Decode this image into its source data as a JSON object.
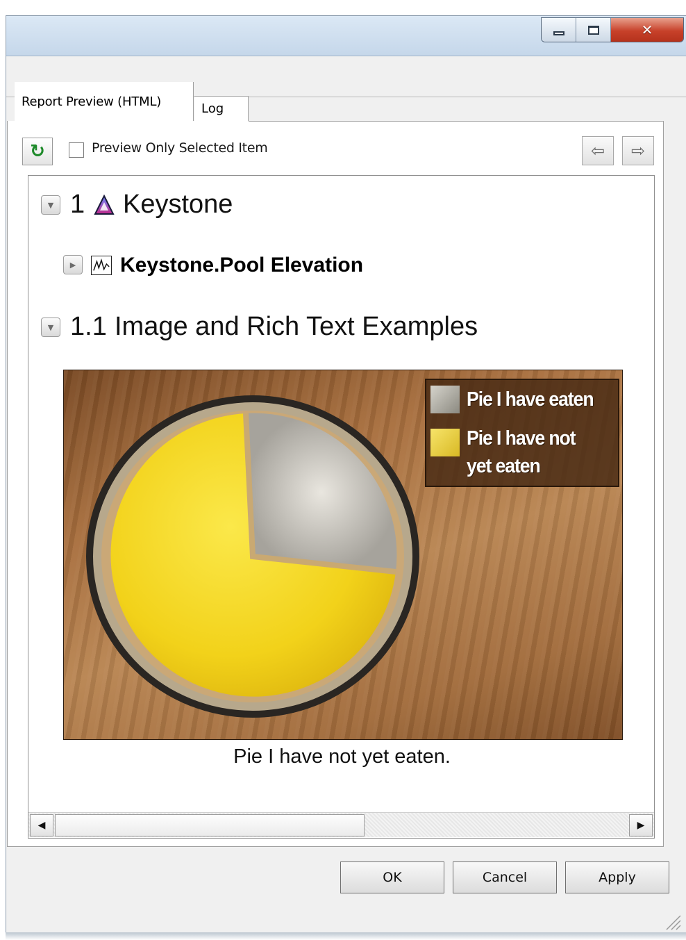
{
  "window": {
    "caption_buttons": {
      "minimize": "minimize",
      "maximize": "maximize",
      "close": "close"
    }
  },
  "tabs": [
    {
      "label": "Report Preview (HTML)",
      "active": true
    },
    {
      "label": "Log",
      "active": false
    }
  ],
  "toolbar": {
    "refresh_icon": "refresh-icon",
    "checkbox_label": "Preview Only Selected Item",
    "checkbox_checked": false,
    "back_icon": "arrow-left-icon",
    "forward_icon": "arrow-right-icon"
  },
  "report": {
    "section1": {
      "number": "1",
      "title": "Keystone",
      "icon": "triangle-icon"
    },
    "subitem": {
      "title": "Keystone.Pool Elevation",
      "icon": "line-chart-icon"
    },
    "section1_1": {
      "number": "1.1",
      "title": "Image and Rich Text Examples"
    },
    "image": {
      "legend": [
        {
          "label": "Pie I have eaten",
          "color": "#c8c6be"
        },
        {
          "label": "Pie I have not yet eaten",
          "color": "#f3dd55"
        }
      ],
      "pie_eaten_fraction": 0.17
    },
    "caption": "Pie I have not yet eaten."
  },
  "buttons": {
    "ok": "OK",
    "cancel": "Cancel",
    "apply": "Apply"
  },
  "colors": {
    "pie_filling": "#f6d718",
    "table_wood": "#a8703d",
    "refresh_green": "#1e8a2a"
  }
}
